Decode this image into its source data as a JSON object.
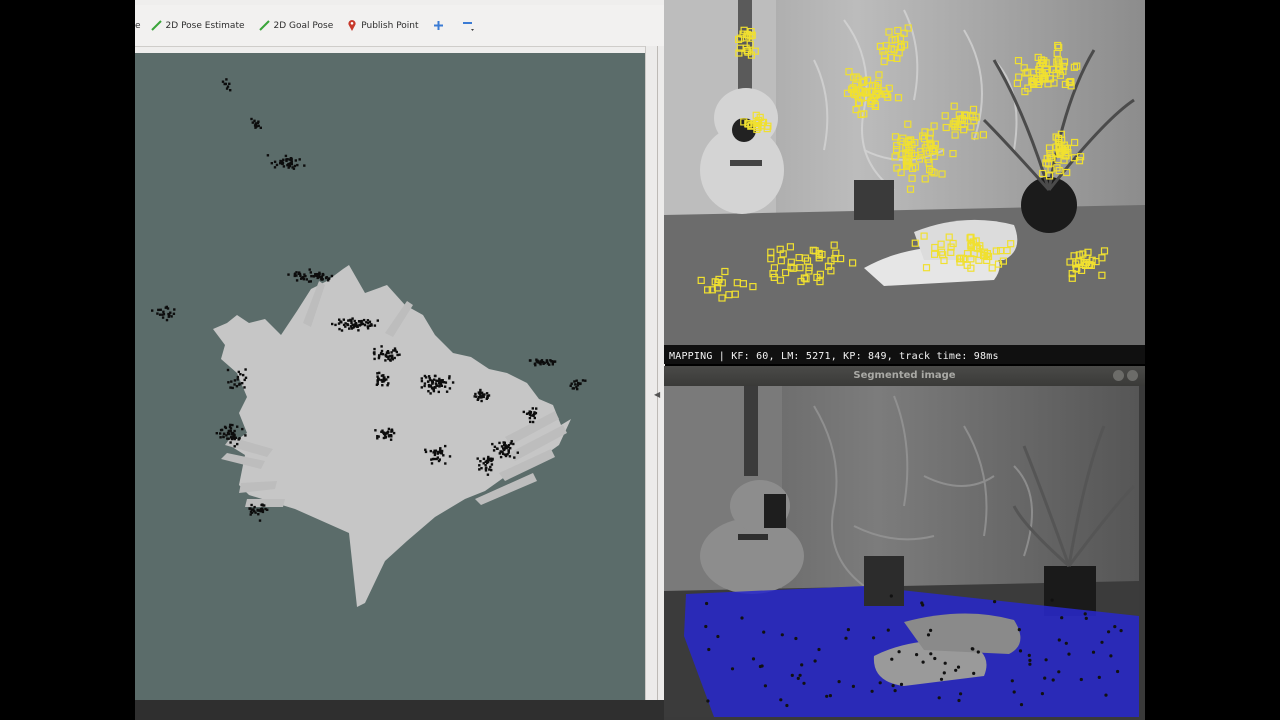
{
  "toolbar": {
    "clipped_left_label": "e",
    "tools": [
      {
        "label": "2D Pose Estimate",
        "icon": "green-arrow-icon"
      },
      {
        "label": "2D Goal Pose",
        "icon": "green-arrow-icon"
      },
      {
        "label": "Publish Point",
        "icon": "location-pin-icon"
      }
    ],
    "zoom_in_icon": "plus-icon",
    "zoom_out_icon": "minus-icon"
  },
  "map": {
    "background_color": "#5b6c6a",
    "free_space_color": "#c6c6c6",
    "point_color": "#0d0d0d"
  },
  "mapping_window": {
    "status_text": "MAPPING | KF: 60, LM: 5271, KP: 849, track time: 98ms",
    "feature_marker_color": "#f0e030"
  },
  "segmented_window": {
    "title": "Segmented image",
    "floor_overlay_color": "#2828c8"
  }
}
